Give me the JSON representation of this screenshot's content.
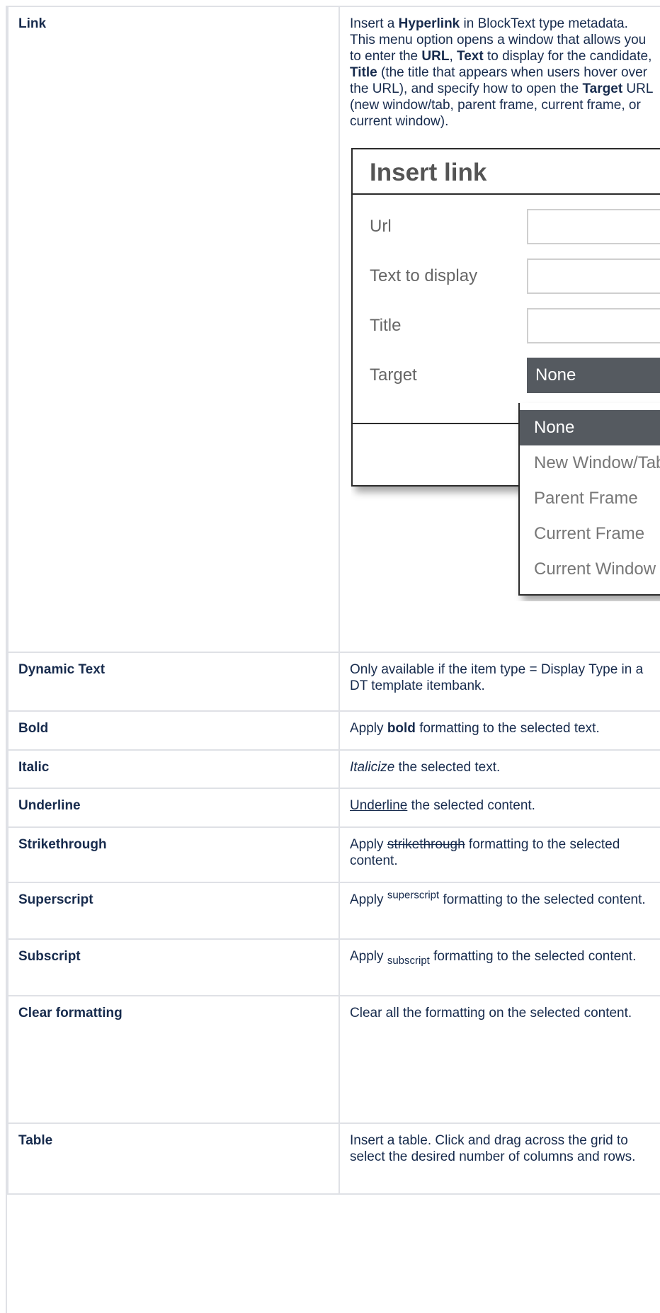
{
  "rows": [
    {
      "name": "Link",
      "desc_parts": [
        "Insert a ",
        "Hyperlink",
        " in BlockText type metadata. This menu option opens a window that allows you to enter the ",
        "URL",
        ", ",
        "Text",
        " to display for the candidate, ",
        "Title",
        " (the title that appears when users hover over the URL), and specify how to open the ",
        "Target",
        " URL (new window/tab, parent frame, current frame, or current window)."
      ]
    },
    {
      "name": "Dynamic Text",
      "desc": "Only available if the item type = Display Type in a DT template itembank."
    },
    {
      "name": "Bold",
      "desc_parts": [
        "Apply ",
        "bold",
        " formatting to the selected text."
      ]
    },
    {
      "name": "Italic",
      "desc_parts": [
        "Italicize",
        " the selected text."
      ]
    },
    {
      "name": "Underline",
      "desc_parts": [
        "Underline",
        " the selected content."
      ]
    },
    {
      "name": "Strikethrough",
      "desc_parts": [
        "Apply ",
        "strikethrough",
        " formatting to the selected content."
      ]
    },
    {
      "name": "Superscript",
      "desc_parts": [
        "Apply ",
        "superscript",
        " formatting to the selected content."
      ]
    },
    {
      "name": "Subscript",
      "desc_parts": [
        "Apply ",
        "subscript",
        " formatting to the selected content."
      ]
    },
    {
      "name": "Clear formatting",
      "desc": "Clear all the formatting on the selected content."
    },
    {
      "name": "Table",
      "desc": "Insert a table. Click and drag across the grid to select the desired number of columns and rows."
    }
  ],
  "dialog": {
    "title": "Insert link",
    "fields": {
      "url": "Url",
      "text": "Text to display",
      "title": "Title",
      "target": "Target"
    },
    "target_value": "None",
    "options": [
      "None",
      "New Window/Tab",
      "Parent Frame",
      "Current Frame",
      "Current Window"
    ]
  }
}
